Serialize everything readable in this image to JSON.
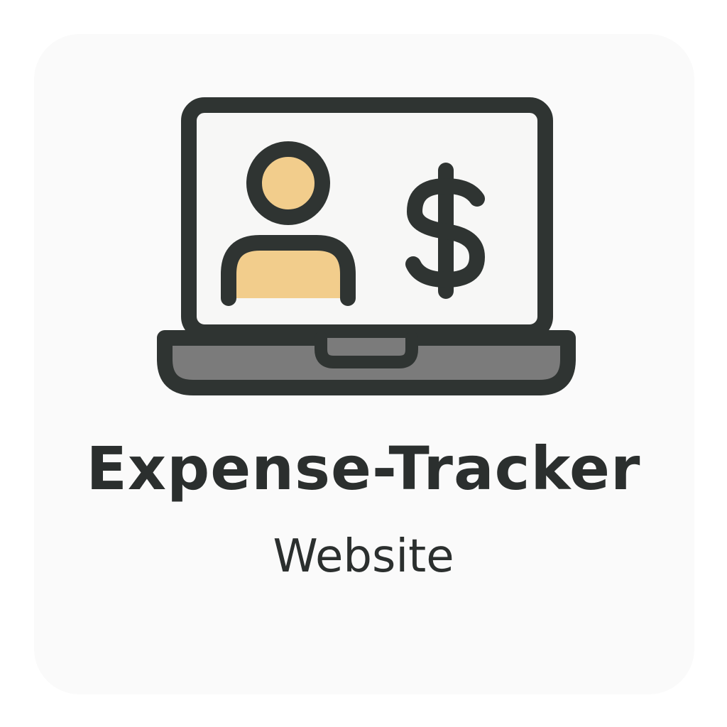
{
  "app": {
    "title": "Expense-Tracker",
    "subtitle": "Website"
  },
  "icons": {
    "laptop": "laptop-icon",
    "user": "user-icon",
    "currency": "dollar-sign-icon"
  },
  "colors": {
    "background": "#fafafa",
    "outline": "#2f3432",
    "screen": "#f7f7f6",
    "accent": "#f2cd8c",
    "base": "#7b7b7b",
    "text": "#2b2f2e"
  }
}
